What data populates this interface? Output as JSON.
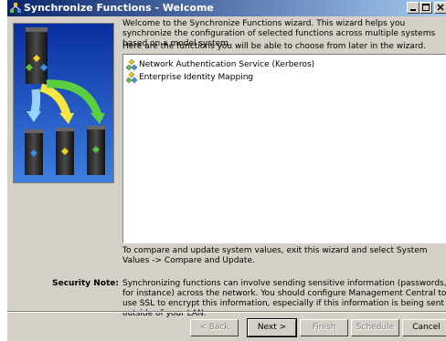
{
  "window": {
    "title": "Synchronize Functions - Welcome",
    "titlebar_start_color": "#0a246a",
    "titlebar_end_color": "#a6caf0",
    "controls": [
      "minimize-icon",
      "maximize-icon",
      "close-icon"
    ]
  },
  "wizard": {
    "welcome_text": "Welcome to the Synchronize Functions wizard.  This wizard helps you synchronize the configuration of selected functions across multiple systems based on a model system.",
    "intro_text": "Here are the functions you will be able to choose from later in the wizard.",
    "functions": [
      {
        "label": "Network Authentication Service (Kerberos)",
        "icon": "function-icon"
      },
      {
        "label": "Enterprise Identity Mapping",
        "icon": "function-icon"
      }
    ],
    "compare_text": "To compare and update system values, exit this wizard and select System Values -> Compare and Update.",
    "security_note_label": "Security Note:",
    "security_note_text": "Synchronizing functions can involve sending sensitive information (passwords, for instance) across the network.  You should configure Management Central to use SSL to encrypt this information, especially if this information is being sent outside of your LAN."
  },
  "buttons": {
    "back": {
      "label": "< Back",
      "enabled": false
    },
    "next": {
      "label": "Next >",
      "enabled": true
    },
    "finish": {
      "label": "Finish",
      "enabled": false
    },
    "schedule": {
      "label": "Schedule",
      "enabled": false
    },
    "cancel": {
      "label": "Cancel",
      "enabled": true
    }
  }
}
